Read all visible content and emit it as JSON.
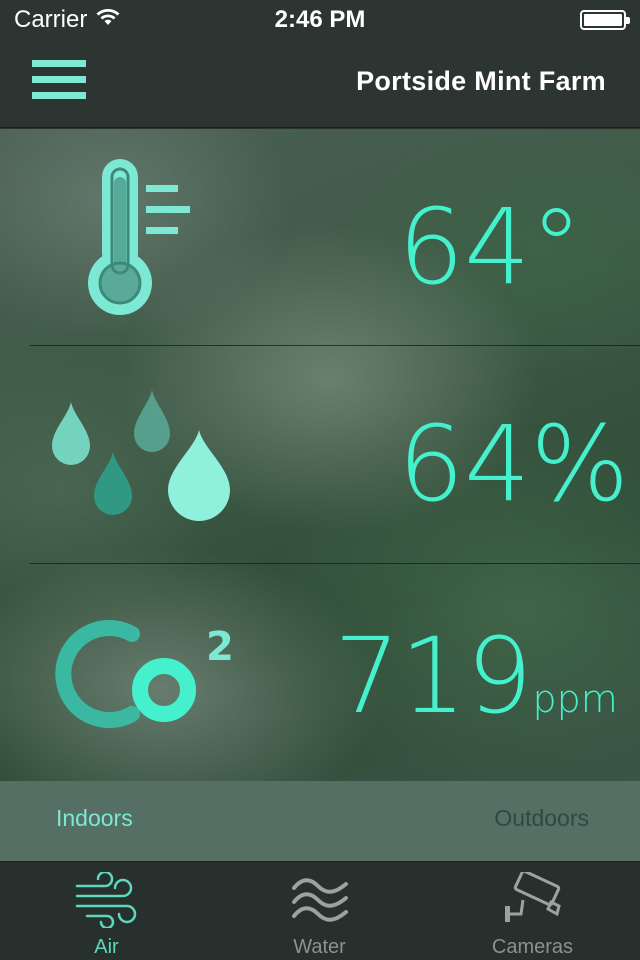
{
  "status_bar": {
    "carrier": "Carrier",
    "time": "2:46 PM"
  },
  "header": {
    "title": "Portside Mint Farm"
  },
  "metrics": {
    "temperature": {
      "value": "64°",
      "icon": "thermometer-icon"
    },
    "humidity": {
      "value": "64%",
      "icon": "water-drops-icon"
    },
    "co2": {
      "value": "719",
      "unit": "ppm",
      "icon": "co2-icon"
    }
  },
  "location_tabs": {
    "indoors": "Indoors",
    "outdoors": "Outdoors",
    "selected": "Indoors"
  },
  "tab_bar": {
    "items": [
      {
        "label": "Air",
        "icon": "wind-icon",
        "active": true
      },
      {
        "label": "Water",
        "icon": "waves-icon",
        "active": false
      },
      {
        "label": "Cameras",
        "icon": "security-camera-icon",
        "active": false
      }
    ]
  },
  "colors": {
    "accent": "#45f0cd",
    "icon_mint": "#7de8d3",
    "icon_teal": "#2f9f8a",
    "bar_background": "#2c3532"
  }
}
